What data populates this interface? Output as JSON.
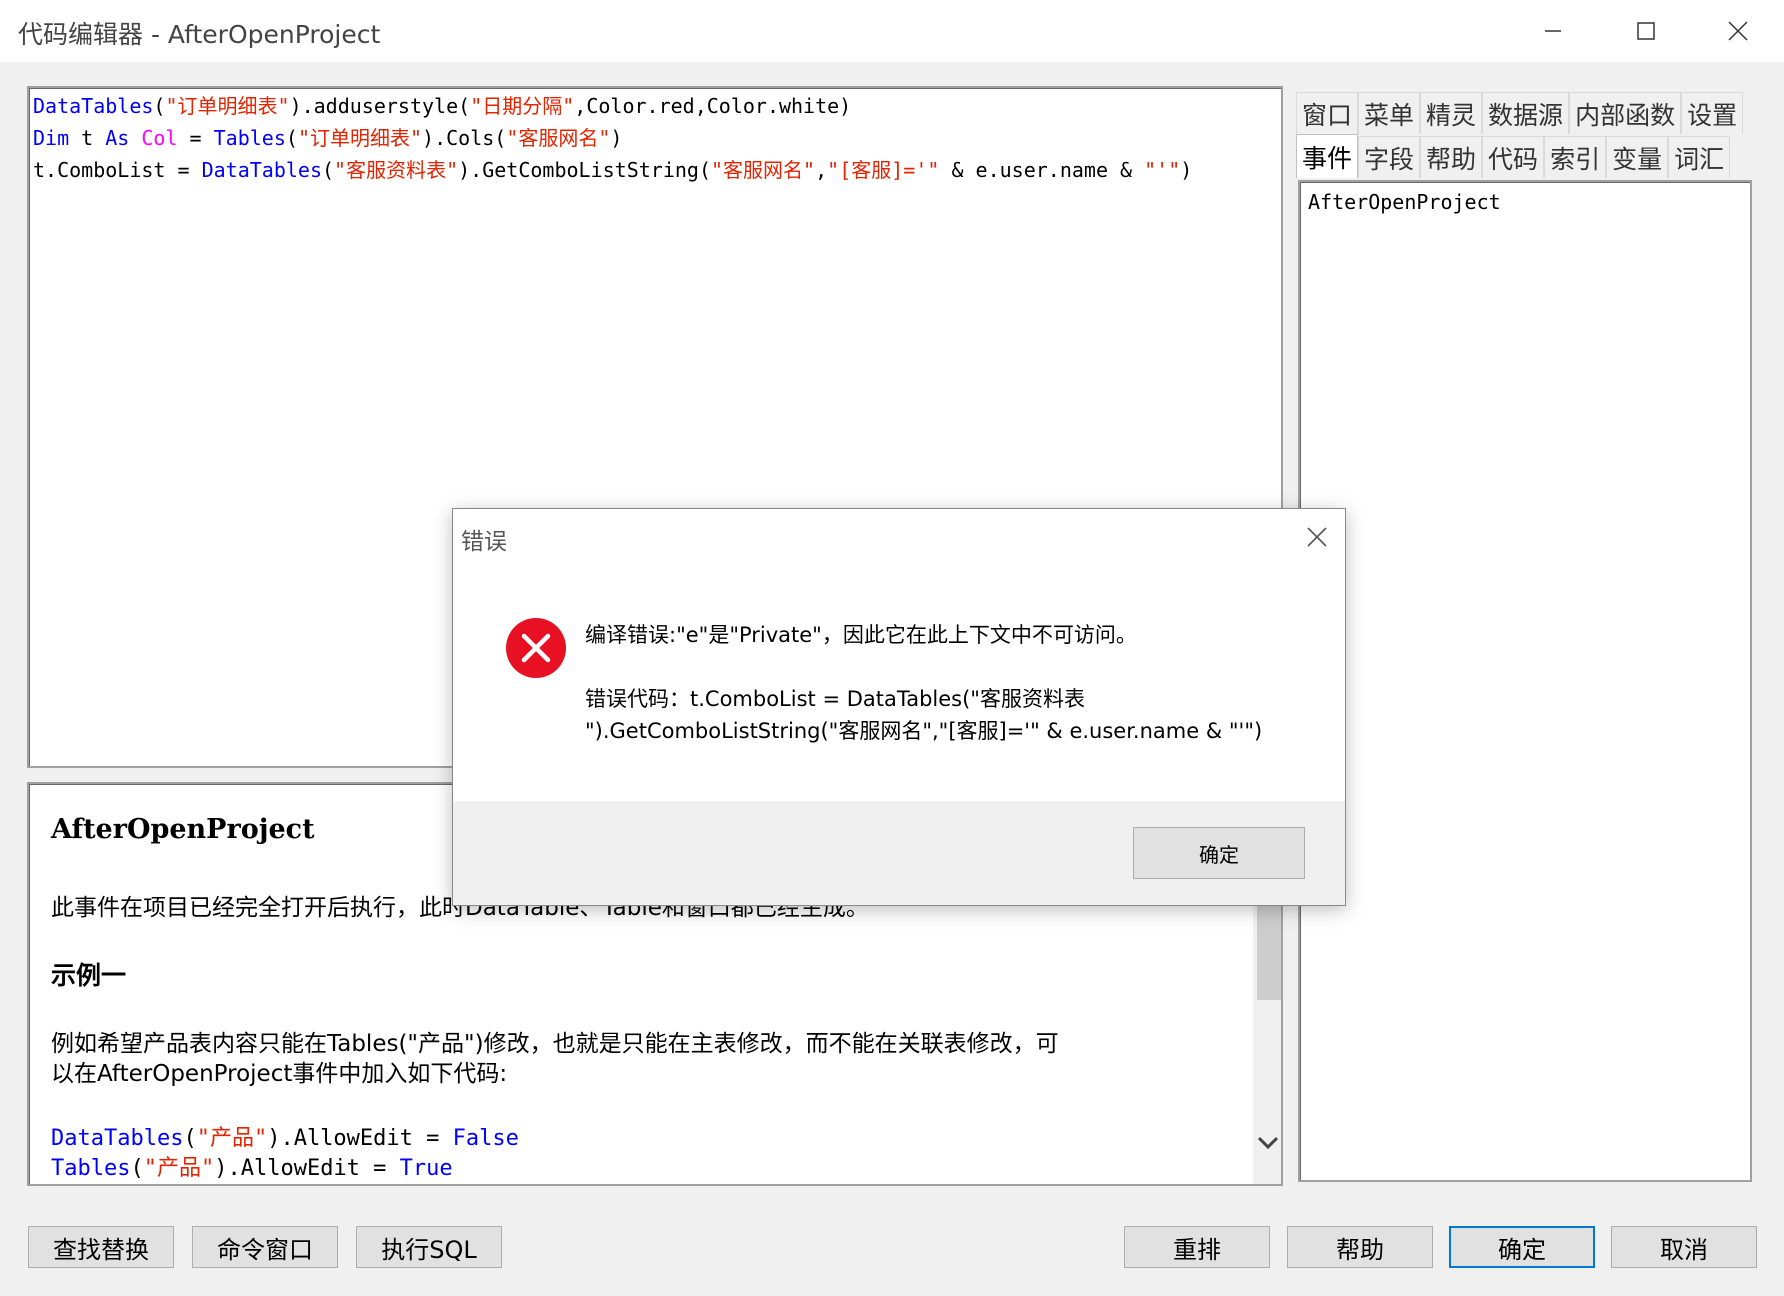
{
  "window": {
    "title": "代码编辑器 - AfterOpenProject",
    "minimize_label": "minimize",
    "maximize_label": "maximize",
    "close_label": "close"
  },
  "code": {
    "line1": [
      {
        "t": "DataTables",
        "c": "kw"
      },
      {
        "t": "(",
        "c": ""
      },
      {
        "t": "\"订单明细表\"",
        "c": "str"
      },
      {
        "t": ").adduserstyle(",
        "c": ""
      },
      {
        "t": "\"日期分隔\"",
        "c": "str"
      },
      {
        "t": ",Color.red,Color.white)",
        "c": ""
      }
    ],
    "line2": [
      {
        "t": "Dim",
        "c": "kw"
      },
      {
        "t": " t ",
        "c": ""
      },
      {
        "t": "As",
        "c": "kw"
      },
      {
        "t": " ",
        "c": ""
      },
      {
        "t": "Col",
        "c": "cls"
      },
      {
        "t": " = ",
        "c": ""
      },
      {
        "t": "Tables",
        "c": "kw"
      },
      {
        "t": "(",
        "c": ""
      },
      {
        "t": "\"订单明细表\"",
        "c": "str"
      },
      {
        "t": ").Cols(",
        "c": ""
      },
      {
        "t": "\"客服网名\"",
        "c": "str"
      },
      {
        "t": ")",
        "c": ""
      }
    ],
    "line3": [
      {
        "t": "t.ComboList = ",
        "c": ""
      },
      {
        "t": "DataTables",
        "c": "kw"
      },
      {
        "t": "(",
        "c": ""
      },
      {
        "t": "\"客服资料表\"",
        "c": "str"
      },
      {
        "t": ").GetComboListString(",
        "c": ""
      },
      {
        "t": "\"客服网名\"",
        "c": "str"
      },
      {
        "t": ",",
        "c": ""
      },
      {
        "t": "\"[客服]='\"",
        "c": "str"
      },
      {
        "t": " & e.user.name & ",
        "c": ""
      },
      {
        "t": "\"'\"",
        "c": "str"
      },
      {
        "t": ")",
        "c": ""
      }
    ]
  },
  "help": {
    "title": "AfterOpenProject",
    "desc": "此事件在项目已经完全打开后执行，此时DataTable、Table和窗口都已经生成。",
    "example_heading": "示例一",
    "example_text_1": "例如希望产品表内容只能在Tables(\"产品\")修改，也就是只能在主表修改，而不能在关联表修改，可",
    "example_text_2": "以在AfterOpenProject事件中加入如下代码:",
    "code1": [
      {
        "t": "DataTables",
        "c": "kw"
      },
      {
        "t": "(",
        "c": ""
      },
      {
        "t": "\"产品\"",
        "c": "str"
      },
      {
        "t": ").AllowEdit = ",
        "c": ""
      },
      {
        "t": "False",
        "c": "kw"
      }
    ],
    "code2": [
      {
        "t": "Tables",
        "c": "kw"
      },
      {
        "t": "(",
        "c": ""
      },
      {
        "t": "\"产品\"",
        "c": "str"
      },
      {
        "t": ").AllowEdit = ",
        "c": ""
      },
      {
        "t": "True",
        "c": "kw"
      }
    ]
  },
  "tabs": {
    "row1": [
      "窗口",
      "菜单",
      "精灵",
      "数据源",
      "内部函数",
      "设置"
    ],
    "row2": [
      "事件",
      "字段",
      "帮助",
      "代码",
      "索引",
      "变量",
      "词汇"
    ],
    "active": "事件"
  },
  "tree": {
    "item": "AfterOpenProject"
  },
  "buttons": {
    "find_replace": "查找替换",
    "command_window": "命令窗口",
    "exec_sql": "执行SQL",
    "rearrange": "重排",
    "help": "帮助",
    "ok": "确定",
    "cancel": "取消"
  },
  "dialog": {
    "title": "错误",
    "message": "编译错误:\"e\"是\"Private\"，因此它在此上下文中不可访问。",
    "code_line_1": "错误代码：t.ComboList = DataTables(\"客服资料表",
    "code_line_2": "\").GetComboListString(\"客服网名\",\"[客服]='\" & e.user.name & \"'\")",
    "ok_label": "确定"
  },
  "colors": {
    "keyword": "#0000ff",
    "string": "#e32400",
    "class": "#ff00ff",
    "error_icon": "#e81123",
    "default_button_border": "#0078d7"
  }
}
